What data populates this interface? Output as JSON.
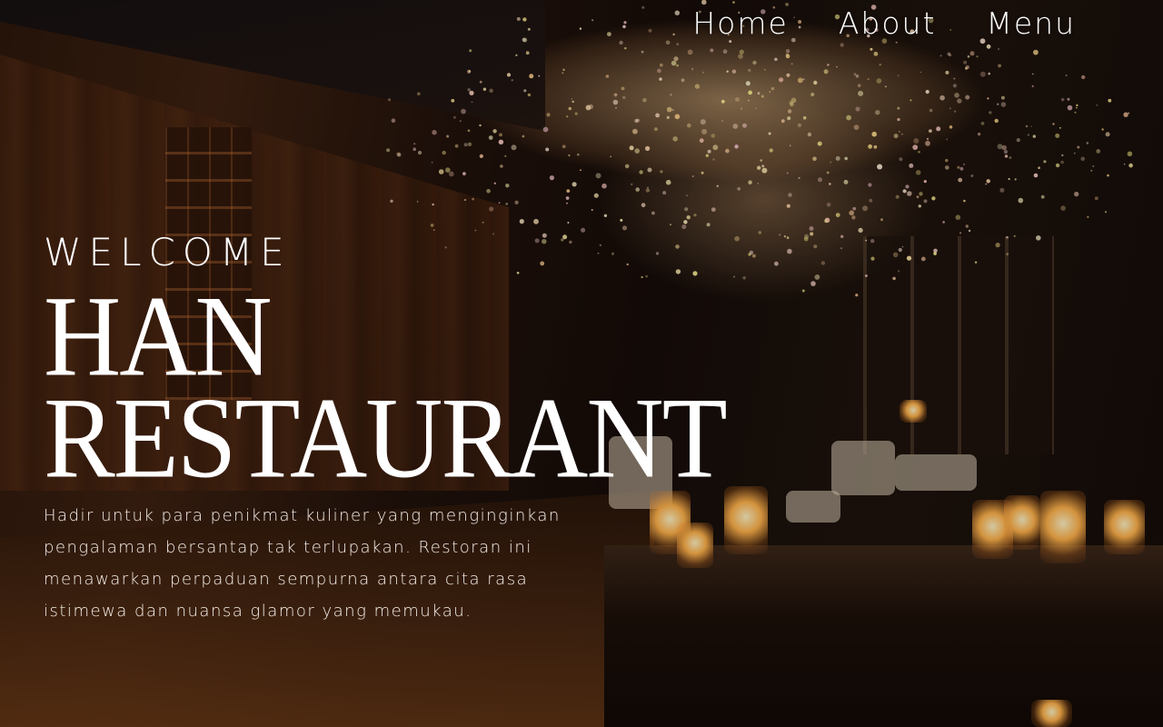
{
  "nav": {
    "items": [
      "Home",
      "About",
      "Menu"
    ]
  },
  "hero": {
    "welcome": "WELCOME",
    "title_line1": "HAN",
    "title_line2": "RESTAURANT",
    "description": "Hadir untuk para penikmat kuliner yang menginginkan pengalaman bersantap tak terlupakan. Restoran ini menawarkan perpaduan sempurna antara cita rasa istimewa dan nuansa glamor yang memukau."
  },
  "colors": {
    "text": "#ffffff",
    "background": "#1a0f08",
    "accent_glow": "#ffb24a"
  }
}
